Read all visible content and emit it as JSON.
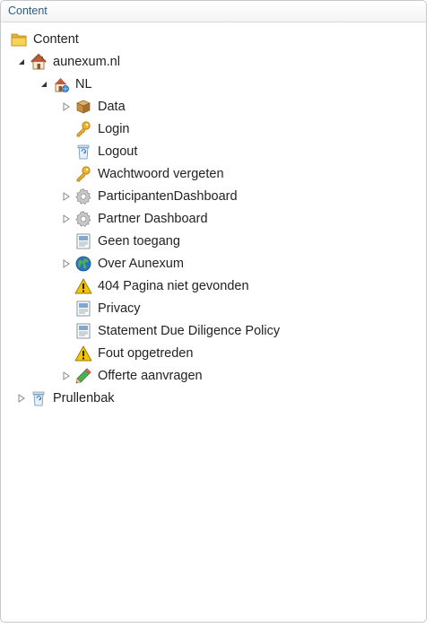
{
  "panel": {
    "title": "Content"
  },
  "tree": {
    "root": {
      "label": "Content",
      "icon": "folder-icon"
    },
    "site": {
      "label": "aunexum.nl",
      "icon": "home-icon",
      "expanded": true
    },
    "lang": {
      "label": "NL",
      "icon": "home-language-icon",
      "expanded": true
    },
    "items": [
      {
        "label": "Data",
        "icon": "box-icon",
        "expandable": true
      },
      {
        "label": "Login",
        "icon": "key-icon",
        "expandable": false
      },
      {
        "label": "Logout",
        "icon": "recycle-bin-icon",
        "expandable": false
      },
      {
        "label": "Wachtwoord vergeten",
        "icon": "key-icon",
        "expandable": false
      },
      {
        "label": "ParticipantenDashboard",
        "icon": "gear-icon",
        "expandable": true
      },
      {
        "label": "Partner Dashboard",
        "icon": "gear-icon",
        "expandable": true
      },
      {
        "label": "Geen toegang",
        "icon": "page-icon",
        "expandable": false
      },
      {
        "label": "Over Aunexum",
        "icon": "globe-icon",
        "expandable": true
      },
      {
        "label": "404 Pagina niet gevonden",
        "icon": "warning-icon",
        "expandable": false
      },
      {
        "label": "Privacy",
        "icon": "page-icon",
        "expandable": false
      },
      {
        "label": "Statement Due Diligence Policy",
        "icon": "page-icon",
        "expandable": false
      },
      {
        "label": "Fout opgetreden",
        "icon": "warning-icon",
        "expandable": false
      },
      {
        "label": "Offerte aanvragen",
        "icon": "pencil-icon",
        "expandable": true
      }
    ],
    "trash": {
      "label": "Prullenbak",
      "icon": "recycle-bin-icon",
      "expandable": true
    }
  }
}
